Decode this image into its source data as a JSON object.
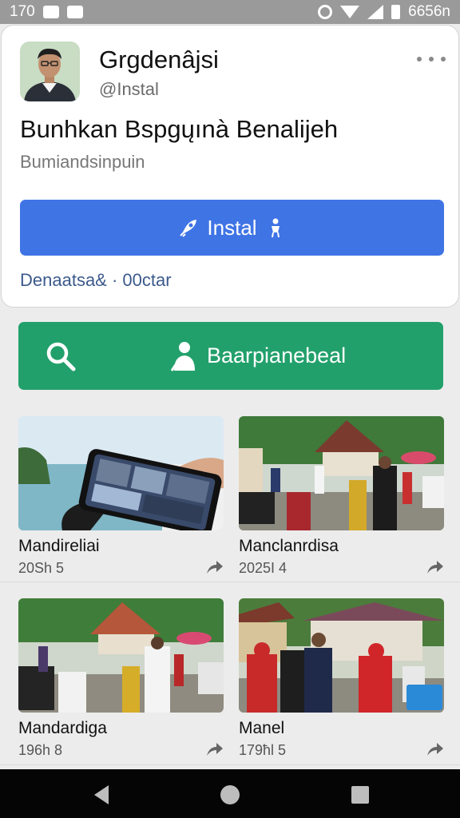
{
  "status_bar": {
    "time": "170",
    "right_text": "6656n",
    "icons": [
      "lock-icon",
      "image-icon",
      "gear-icon",
      "wifi-icon",
      "signal-icon",
      "battery-icon"
    ]
  },
  "card": {
    "name": "Grgdenâjsi",
    "handle": "@Instal",
    "title": "Bunhkan Bspgųınà Benalijeh",
    "subtitle": "Bumiandsinpuin",
    "install_label": "Instal",
    "meta": "Denaatsa& · 00ctar"
  },
  "search_button": {
    "label": "Baarpianebeal"
  },
  "grid": [
    {
      "title": "Mandireliai",
      "date": "20Sh 5"
    },
    {
      "title": "Manclanrdisa",
      "date": "2025I 4"
    },
    {
      "title": "Mandardiga",
      "date": "196h 8"
    },
    {
      "title": "Manel",
      "date": "179ħl 5"
    }
  ],
  "colors": {
    "primary": "#3f74e5",
    "green": "#22a06b",
    "statusbar": "#9a9a9a",
    "navbar": "#050505"
  }
}
